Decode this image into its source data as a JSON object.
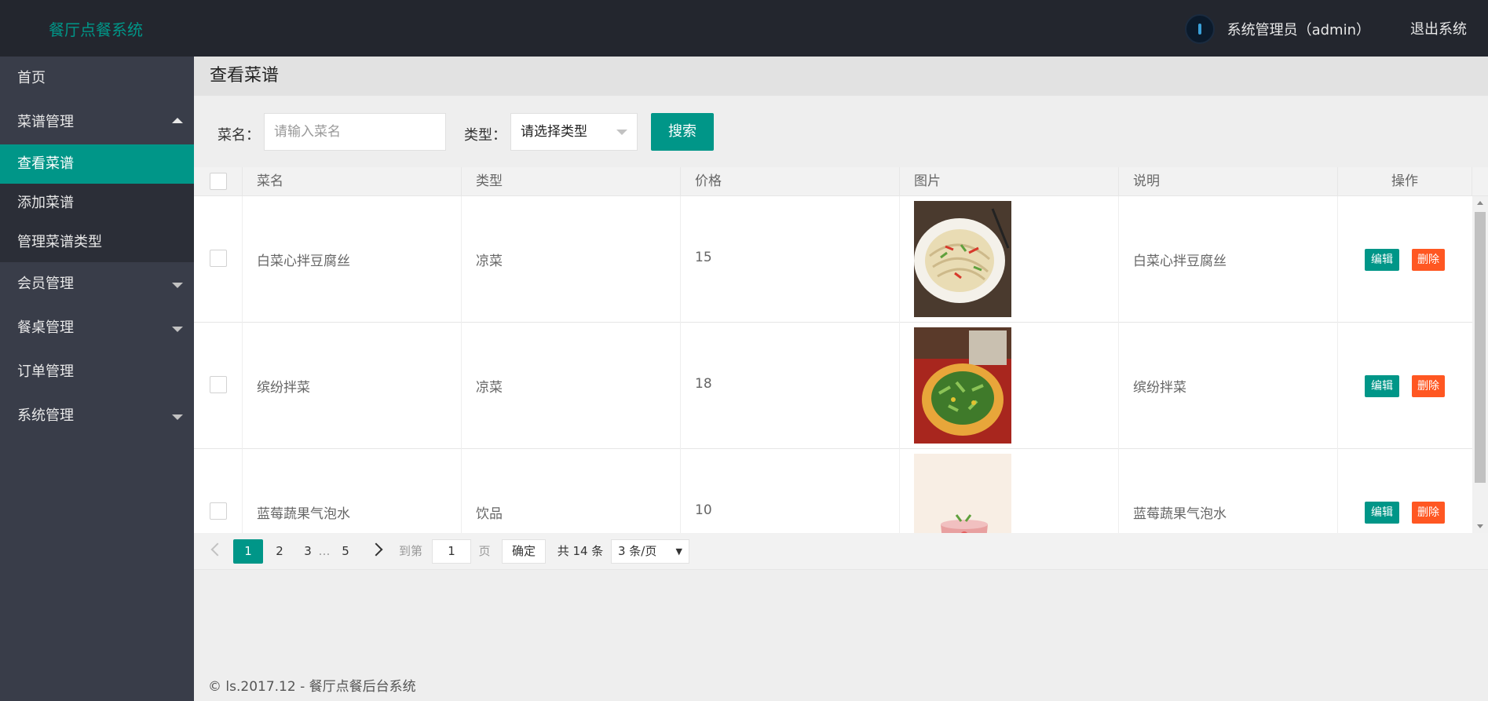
{
  "header": {
    "app_title": "餐厅点餐系统",
    "user_name": "系统管理员（admin）",
    "logout": "退出系统"
  },
  "sidebar": {
    "home": "首页",
    "menu_mgmt": "菜谱管理",
    "sub_items": [
      "查看菜谱",
      "添加菜谱",
      "管理菜谱类型"
    ],
    "member_mgmt": "会员管理",
    "table_mgmt": "餐桌管理",
    "order_mgmt": "订单管理",
    "system_mgmt": "系统管理"
  },
  "page": {
    "title": "查看菜谱"
  },
  "search": {
    "name_label": "菜名：",
    "name_placeholder": "请输入菜名",
    "type_label": "类型：",
    "type_selected": "请选择类型",
    "button": "搜索"
  },
  "table": {
    "columns": [
      "菜名",
      "类型",
      "价格",
      "图片",
      "说明",
      "操作"
    ],
    "rows": [
      {
        "name": "白菜心拌豆腐丝",
        "type": "凉菜",
        "price": "15",
        "desc": "白菜心拌豆腐丝",
        "image": "noodle-salad-photo"
      },
      {
        "name": "缤纷拌菜",
        "type": "凉菜",
        "price": "18",
        "desc": "缤纷拌菜",
        "image": "greens-salad-photo"
      },
      {
        "name": "蓝莓蔬果气泡水",
        "type": "饮品",
        "price": "10",
        "desc": "蓝莓蔬果气泡水",
        "image": "fruit-drink-photo"
      }
    ],
    "edit_label": "编辑",
    "delete_label": "删除"
  },
  "pagination": {
    "pages": [
      "1",
      "2",
      "3",
      "…",
      "5"
    ],
    "current": "1",
    "goto_label": "到第",
    "goto_value": "1",
    "page_unit": "页",
    "confirm": "确定",
    "total": "共 14 条",
    "per_page": "3 条/页"
  },
  "footer": {
    "text": "© ls.2017.12 - 餐厅点餐后台系统"
  },
  "colors": {
    "accent": "#009688",
    "danger": "#ff5722",
    "header_bg": "#23262e",
    "sidebar_bg": "#393d49"
  }
}
